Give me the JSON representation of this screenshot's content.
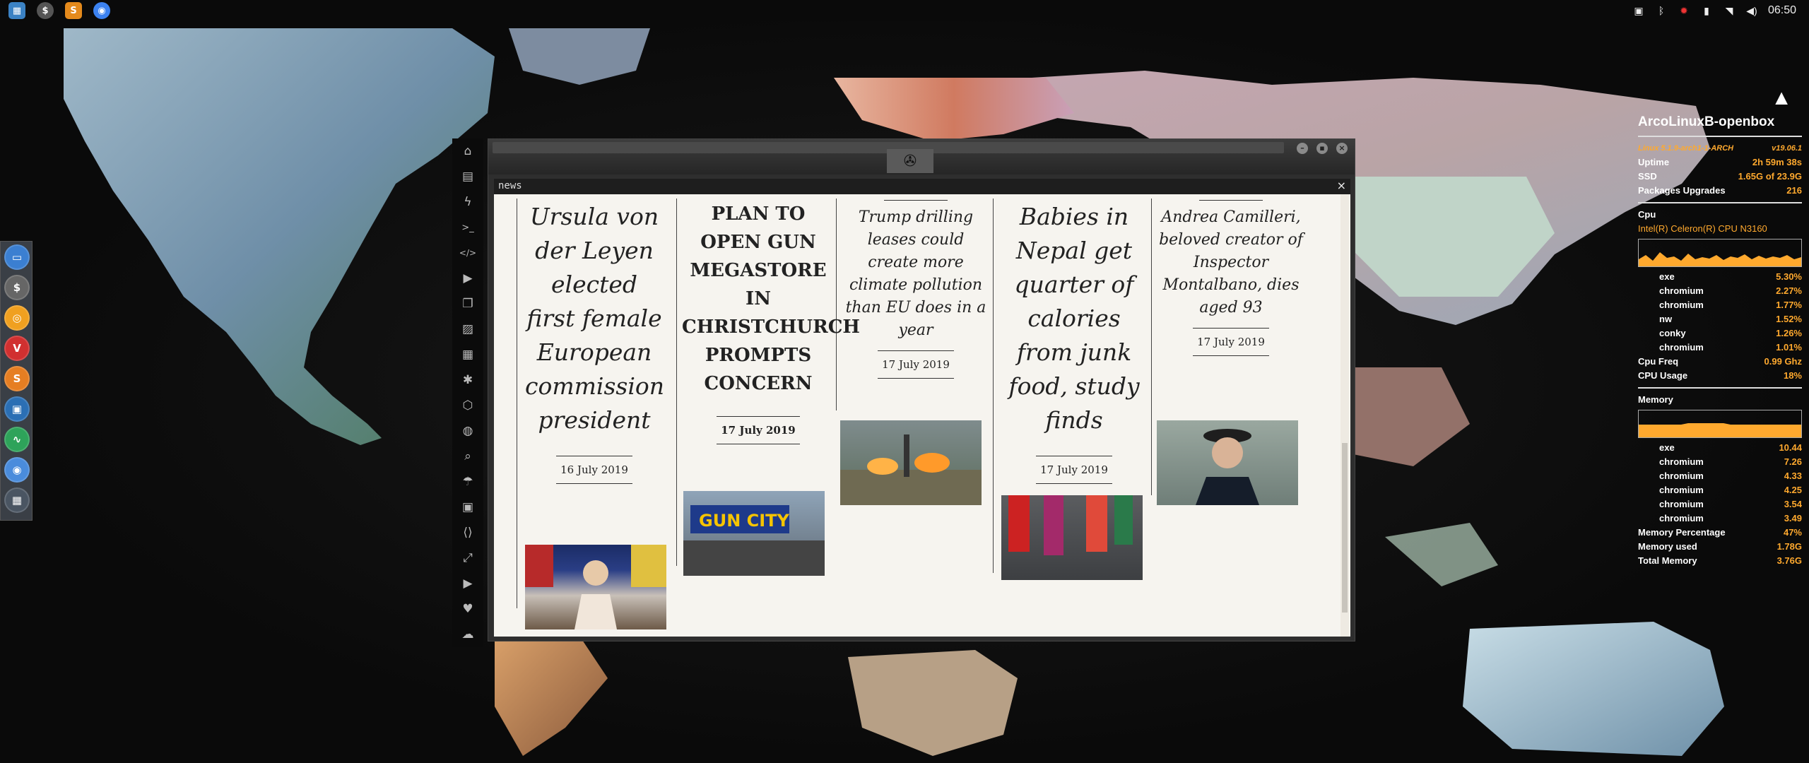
{
  "topbar": {
    "apps": [
      {
        "name": "file-manager",
        "color": "#3b82c4",
        "glyph": "▦"
      },
      {
        "name": "stacer",
        "color": "#555",
        "glyph": "$"
      },
      {
        "name": "sublime",
        "color": "#e48a1c",
        "glyph": "S"
      },
      {
        "name": "chromium",
        "color": "#3c82f0",
        "glyph": "◉"
      }
    ],
    "clock": "06:50"
  },
  "dock": {
    "items": [
      {
        "label": "",
        "color": "#3b7fd1",
        "glyph": "▭"
      },
      {
        "label": "",
        "color": "#666",
        "glyph": "$"
      },
      {
        "label": "",
        "color": "#f0a020",
        "glyph": "◎"
      },
      {
        "label": "",
        "color": "#d13030",
        "glyph": "V"
      },
      {
        "label": "",
        "color": "#e67e22",
        "glyph": "S"
      },
      {
        "label": "",
        "color": "#2b6fb4",
        "glyph": "▣"
      },
      {
        "label": "",
        "color": "#2ea35a",
        "glyph": "∿"
      },
      {
        "label": "",
        "color": "#4a8cdc",
        "glyph": "◉"
      },
      {
        "label": "",
        "color": "#4a5562",
        "glyph": "▦"
      }
    ]
  },
  "sidebar": {
    "icons": [
      "home-icon",
      "document-icon",
      "bolt-icon",
      "terminal-icon",
      "code-icon",
      "play-icon",
      "files-icon",
      "image-icon",
      "newspaper-icon",
      "atom-icon",
      "hexagon-icon",
      "globe-icon",
      "search-icon",
      "umbrella-icon",
      "contact-icon",
      "code-brackets-icon",
      "expand-icon",
      "youtube-icon",
      "heart-icon",
      "cloud-icon"
    ],
    "glyphs": [
      "⌂",
      "▤",
      "ϟ",
      ">_",
      "</>",
      "▶",
      "❐",
      "▨",
      "▦",
      "✱",
      "⬡",
      "◍",
      "⌕",
      "☂",
      "▣",
      "⟨⟩",
      "⤢",
      "▶",
      "♥",
      "☁"
    ]
  },
  "window": {
    "tab_label": "news",
    "close_glyph": "×",
    "articles": [
      {
        "title": "Ursula von der Leyen elected first female European commission president",
        "date": "16 July 2019"
      },
      {
        "title": "PLAN TO OPEN GUN MEGASTORE IN CHRISTCHURCH PROMPTS CONCERN",
        "date": "17 July 2019",
        "image_text": "GUN CITY"
      },
      {
        "title": "Trump drilling leases could create more climate pollution than EU does in a year",
        "date": "17 July 2019"
      },
      {
        "title": "Babies in Nepal get quarter of calories from junk food, study finds",
        "date": "17 July 2019"
      },
      {
        "title": "Andrea Camilleri, beloved creator of Inspector Montalbano, dies aged 93",
        "date": "17 July 2019"
      }
    ]
  },
  "conky": {
    "host": "ArcoLinuxB-openbox",
    "kernel": "Linux 5.1.9-arch1-1-ARCH",
    "version": "v19.06.1",
    "uptime_label": "Uptime",
    "uptime": "2h 59m 38s",
    "ssd_label": "SSD",
    "ssd": "1.65G of 23.9G",
    "pkg_label": "Packages Upgrades",
    "pkg": "216",
    "cpu_label": "Cpu",
    "cpu_model": "Intel(R) Celeron(R) CPU  N3160",
    "cpu_procs": [
      {
        "name": "exe",
        "val": "5.30%"
      },
      {
        "name": "chromium",
        "val": "2.27%"
      },
      {
        "name": "chromium",
        "val": "1.77%"
      },
      {
        "name": "nw",
        "val": "1.52%"
      },
      {
        "name": "conky",
        "val": "1.26%"
      },
      {
        "name": "chromium",
        "val": "1.01%"
      }
    ],
    "cpu_freq_label": "Cpu Freq",
    "cpu_freq": "0.99 Ghz",
    "cpu_usage_label": "CPU Usage",
    "cpu_usage": "18%",
    "mem_label": "Memory",
    "mem_procs": [
      {
        "name": "exe",
        "val": "10.44"
      },
      {
        "name": "chromium",
        "val": "7.26"
      },
      {
        "name": "chromium",
        "val": "4.33"
      },
      {
        "name": "chromium",
        "val": "4.25"
      },
      {
        "name": "chromium",
        "val": "3.54"
      },
      {
        "name": "chromium",
        "val": "3.49"
      }
    ],
    "mem_pct_label": "Memory Percentage",
    "mem_pct": "47%",
    "mem_used_label": "Memory used",
    "mem_used": "1.78G",
    "mem_total_label": "Total Memory",
    "mem_total": "3.76G",
    "accent": "#ffa92e"
  }
}
